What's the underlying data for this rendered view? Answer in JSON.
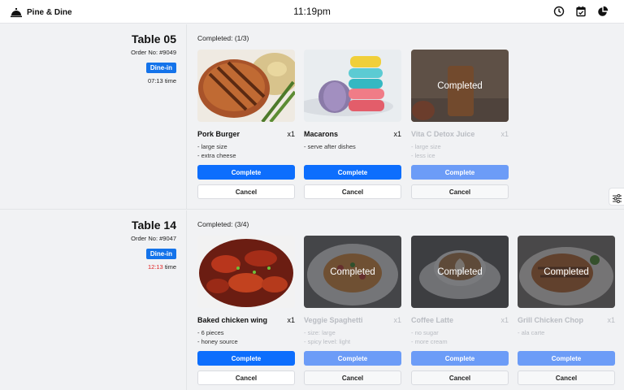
{
  "app": {
    "name": "Pine & Dine",
    "clock": "11:19pm"
  },
  "header_icons": [
    "clock-icon",
    "calendar-check-icon",
    "pie-chart-icon"
  ],
  "colors": {
    "primary": "#1473ea",
    "complete_button": "#0d6efd",
    "complete_button_done": "#6c9cf7",
    "urgent_time": "#e02424"
  },
  "orders": [
    {
      "table": "Table 05",
      "order_no": "Order No: #9049",
      "type": "Dine-in",
      "time_value": "07:13",
      "time_suffix": "time",
      "completed": "Completed: (1/3)",
      "items": [
        {
          "name": "Pork Burger",
          "qty": "x1",
          "notes": [
            "- large size",
            "- extra cheese"
          ],
          "status": ""
        },
        {
          "name": "Macarons",
          "qty": "x1",
          "notes": [
            "- serve after dishes"
          ],
          "status": ""
        },
        {
          "name": "Vita C Detox Juice",
          "qty": "x1",
          "notes": [
            "- large size",
            "- less ice"
          ],
          "status": "Completed"
        }
      ]
    },
    {
      "table": "Table 14",
      "order_no": "Order No: #9047",
      "type": "Dine-in",
      "time_value": "12:13",
      "time_suffix": "time",
      "completed": "Completed: (3/4)",
      "items": [
        {
          "name": "Baked chicken wing",
          "qty": "x1",
          "notes": [
            "- 6 pieces",
            "- honey source"
          ],
          "status": ""
        },
        {
          "name": "Veggie Spaghetti",
          "qty": "x1",
          "notes": [
            "- size: large",
            "- spicy level: light"
          ],
          "status": "Completed"
        },
        {
          "name": "Coffee Latte",
          "qty": "x1",
          "notes": [
            "- no sugar",
            "- more cream"
          ],
          "status": "Completed"
        },
        {
          "name": "Grill Chicken Chop",
          "qty": "x1",
          "notes": [
            "- ala carte"
          ],
          "status": "Completed"
        }
      ]
    }
  ],
  "buttons": {
    "complete": "Complete",
    "cancel": "Cancel"
  }
}
